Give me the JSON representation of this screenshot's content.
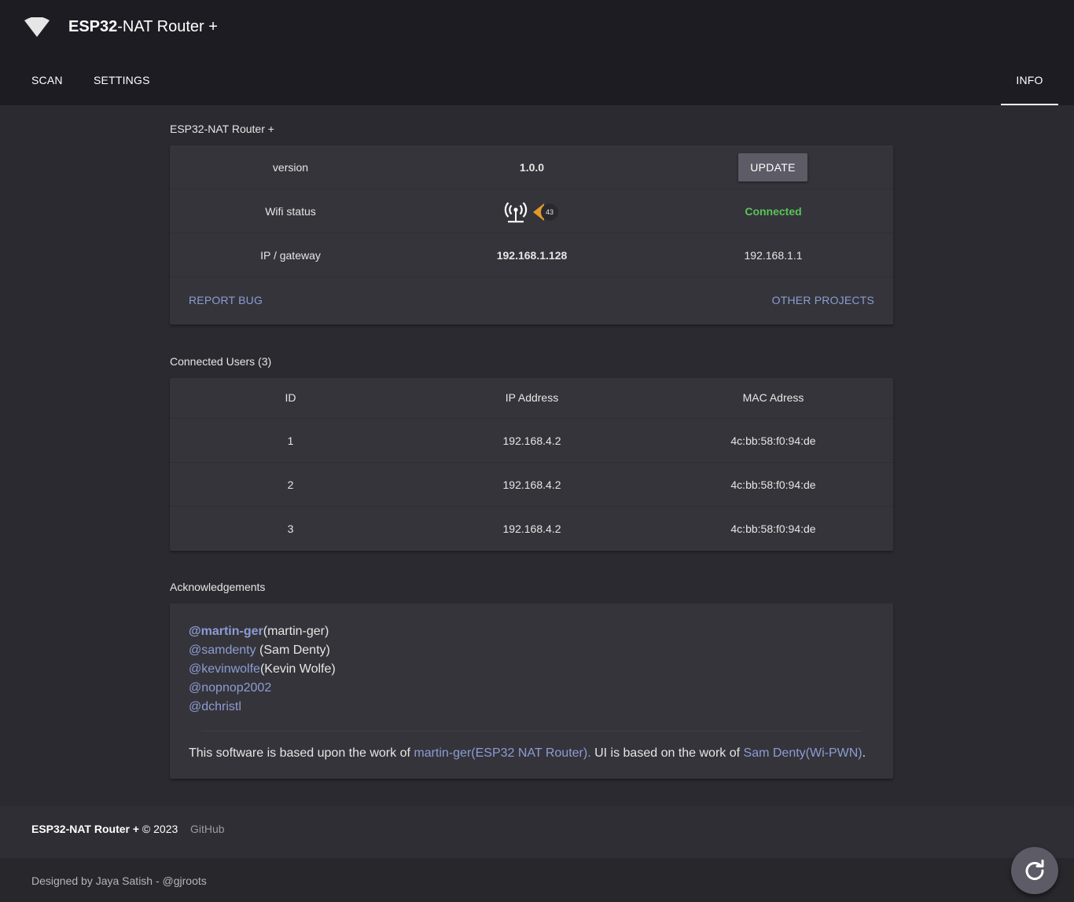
{
  "header": {
    "title_bold": "ESP32",
    "title_rest": "-NAT Router +",
    "icon": "wifi-icon"
  },
  "nav": {
    "tabs": [
      {
        "label": "SCAN",
        "active": false
      },
      {
        "label": "SETTINGS",
        "active": false
      },
      {
        "label": "INFO",
        "active": true
      }
    ]
  },
  "info": {
    "section_title": "ESP32-NAT Router +",
    "version_label": "version",
    "version_value": "1.0.0",
    "update_label": "UPDATE",
    "wifi_label": "Wifi status",
    "wifi_icon": "antenna-signal-icon",
    "signal_value": "43",
    "wifi_status": "Connected",
    "ip_label": "IP / gateway",
    "ip_value": "192.168.1.128",
    "gateway_value": "192.168.1.1",
    "report_bug": "REPORT BUG",
    "other_projects": "OTHER PROJECTS",
    "status_color": "#58c35a",
    "signal_color": "#e09a2a"
  },
  "users": {
    "section_title": "Connected Users (3)",
    "headers": [
      "ID",
      "IP Address",
      "MAC Adress"
    ],
    "rows": [
      [
        "1",
        "192.168.4.2",
        "4c:bb:58:f0:94:de"
      ],
      [
        "2",
        "192.168.4.2",
        "4c:bb:58:f0:94:de"
      ],
      [
        "3",
        "192.168.4.2",
        "4c:bb:58:f0:94:de"
      ]
    ]
  },
  "ack": {
    "section_title": "Acknowledgements",
    "people": [
      {
        "handle": "@martin-ger",
        "name": "(martin-ger)"
      },
      {
        "handle": "@samdenty",
        "name": " (Sam Denty)"
      },
      {
        "handle": "@kevinwolfe",
        "name": "(Kevin Wolfe)"
      },
      {
        "handle": "@nopnop2002",
        "name": ""
      },
      {
        "handle": "@dchristl",
        "name": ""
      }
    ],
    "note_prefix": "This software is based upon the work of ",
    "note_link1": "martin-ger(ESP32 NAT Router).",
    "note_middle": " UI is based on the work of ",
    "note_link2": "Sam Denty(Wi-PWN)",
    "note_suffix": "."
  },
  "footer": {
    "brand": "ESP32-NAT Router +",
    "copyright": " © 2023",
    "github": "GitHub",
    "designed": "Designed by Jaya Satish - @gjroots",
    "refresh_icon": "refresh-icon"
  },
  "colors": {
    "accent_link": "#8b9dd4",
    "appbar": "#1d1c22",
    "background": "#2b2a30",
    "card": "#35343a"
  }
}
